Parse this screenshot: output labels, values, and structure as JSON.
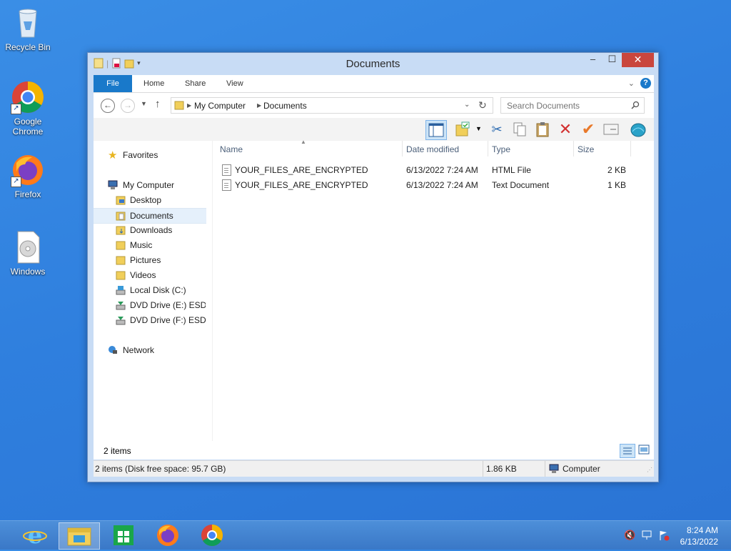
{
  "desktop": {
    "icons": [
      {
        "label": "Recycle Bin",
        "icon": "recycle-bin-icon"
      },
      {
        "label": "Google\nChrome",
        "icon": "chrome-icon"
      },
      {
        "label": "Firefox",
        "icon": "firefox-icon"
      },
      {
        "label": "Windows",
        "icon": "disc-image-icon"
      }
    ]
  },
  "window": {
    "title": "Documents",
    "close_glyph": "✕",
    "maximize_glyph": "☐",
    "minimize_glyph": "–",
    "ribbon_tabs": [
      "File",
      "Home",
      "Share",
      "View"
    ],
    "address": {
      "parts": [
        "My Computer",
        "Documents"
      ]
    },
    "search_placeholder": "Search Documents",
    "nav": {
      "favorites": "Favorites",
      "computer": "My Computer",
      "items": [
        "Desktop",
        "Documents",
        "Downloads",
        "Music",
        "Pictures",
        "Videos",
        "Local Disk (C:)",
        "DVD Drive (E:) ESD-IS",
        "DVD Drive (F:) ESD-IS"
      ],
      "selected": "Documents",
      "network": "Network"
    },
    "columns": [
      "Name",
      "Date modified",
      "Type",
      "Size"
    ],
    "files": [
      {
        "name": "YOUR_FILES_ARE_ENCRYPTED",
        "date": "6/13/2022 7:24 AM",
        "type": "HTML File",
        "size": "2 KB"
      },
      {
        "name": "YOUR_FILES_ARE_ENCRYPTED",
        "date": "6/13/2022 7:24 AM",
        "type": "Text Document",
        "size": "1 KB"
      }
    ],
    "item_count": "2 items",
    "status": {
      "left": "2 items (Disk free space: 95.7 GB)",
      "size": "1.86 KB",
      "location": "Computer"
    }
  },
  "taskbar": {
    "apps": [
      "internet-explorer-icon",
      "file-explorer-icon",
      "store-icon",
      "firefox-icon",
      "chrome-icon"
    ],
    "active": "file-explorer-icon",
    "time": "8:24 AM",
    "date": "6/13/2022"
  }
}
